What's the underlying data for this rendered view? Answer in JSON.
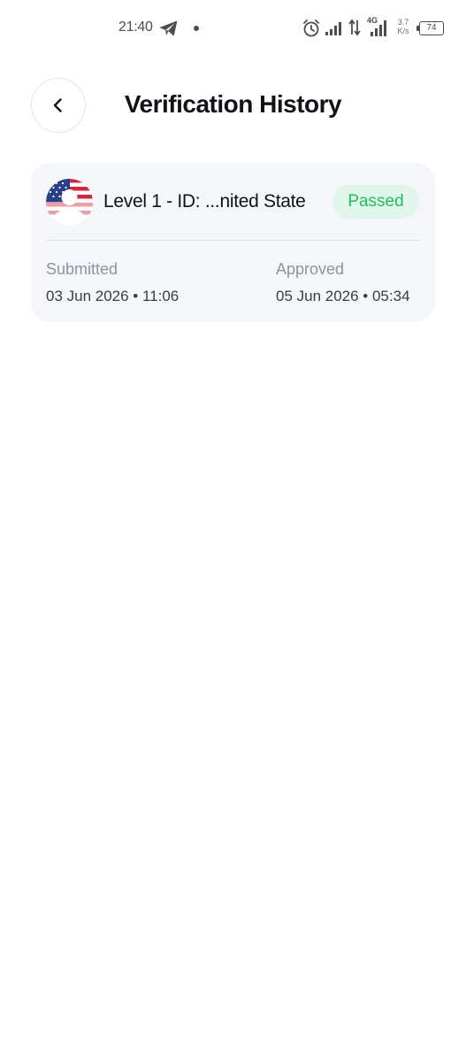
{
  "status_bar": {
    "time": "21:40",
    "lte": "4G",
    "speed_value": "3.7",
    "speed_unit": "K/s",
    "battery": "74",
    "battery_level": 0.74
  },
  "header": {
    "title": "Verification History",
    "back_icon": "chevron-left-icon"
  },
  "record": {
    "flag_icon": "us-flag-icon",
    "title": "Level 1 - ID: ...nited State",
    "status": "Passed",
    "submitted_label": "Submitted",
    "submitted_value": "03 Jun 2026 • 11:06",
    "approved_label": "Approved",
    "approved_value": "05 Jun 2026 • 05:34",
    "status_color": "#1fbf61",
    "status_bg": "#e2f5ea"
  }
}
